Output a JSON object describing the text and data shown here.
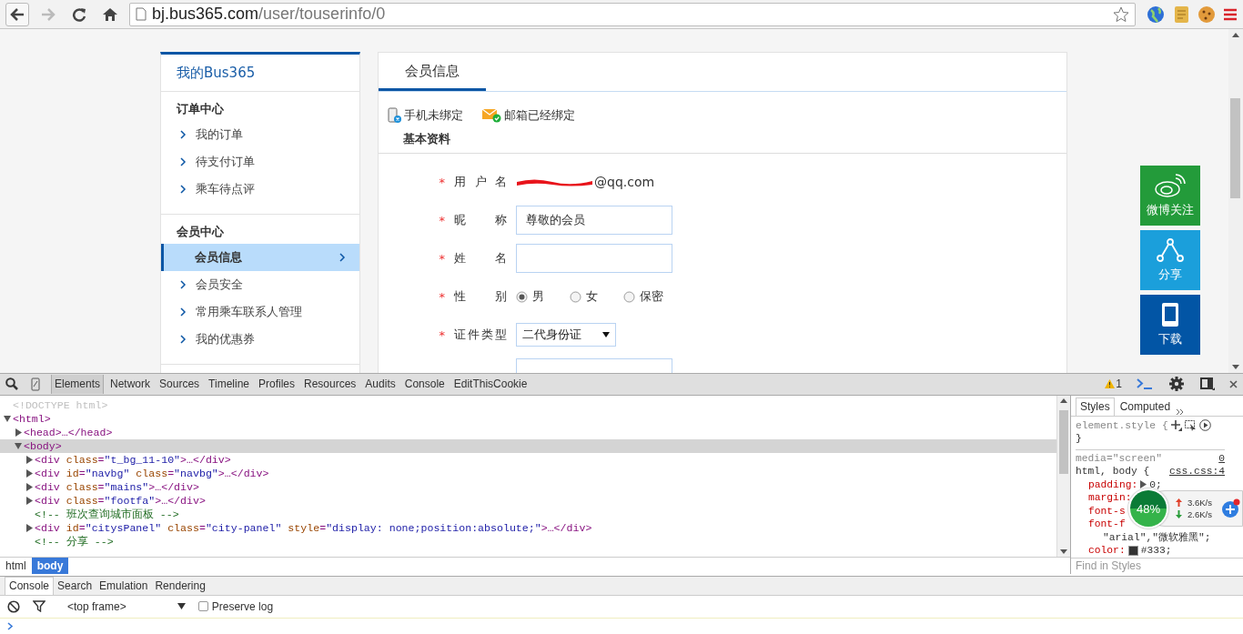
{
  "browser": {
    "url_host": "bj.bus365.com",
    "url_path": "/user/touserinfo/0",
    "forward_disabled": true
  },
  "sidebar": {
    "title": "我的Bus365",
    "groups": [
      {
        "heading": "订单中心",
        "items": [
          {
            "label": "我的订单",
            "selected": false
          },
          {
            "label": "待支付订单",
            "selected": false
          },
          {
            "label": "乘车待点评",
            "selected": false
          }
        ]
      },
      {
        "heading": "会员中心",
        "items": [
          {
            "label": "会员信息",
            "selected": true
          },
          {
            "label": "会员安全",
            "selected": false
          },
          {
            "label": "常用乘车联系人管理",
            "selected": false
          },
          {
            "label": "我的优惠券",
            "selected": false
          }
        ]
      }
    ]
  },
  "main": {
    "tab": "会员信息",
    "bindings": [
      {
        "kind": "phone",
        "label": "手机未绑定"
      },
      {
        "kind": "email",
        "label": "邮箱已经绑定"
      }
    ],
    "section": "基本资料",
    "fields": [
      {
        "kind": "text",
        "mark": "*",
        "label": "用户名",
        "value": "@qq.com",
        "redacted": true
      },
      {
        "kind": "input",
        "mark": "*",
        "label": "昵称",
        "value": "尊敬的会员"
      },
      {
        "kind": "input",
        "mark": "*",
        "label": "姓名"
      },
      {
        "kind": "radio",
        "mark": "*",
        "label": "性别",
        "options": [
          {
            "label": "男",
            "selected": true
          },
          {
            "label": "女",
            "selected": false
          },
          {
            "label": "保密",
            "selected": false
          }
        ]
      },
      {
        "kind": "select",
        "mark": "*",
        "label": "证件类型",
        "value": "二代身份证"
      },
      {
        "kind": "input"
      }
    ]
  },
  "side_buttons": [
    {
      "kind": "weibo",
      "label": "微博关注",
      "color": "#239b3a"
    },
    {
      "kind": "share",
      "label": "分享",
      "color": "#1b9fdb"
    },
    {
      "kind": "download",
      "label": "下载",
      "color": "#0255a5"
    }
  ],
  "devtools": {
    "tabs": [
      {
        "label": "Elements",
        "selected": true
      },
      {
        "label": "Network",
        "selected": false
      },
      {
        "label": "Sources",
        "selected": false
      },
      {
        "label": "Timeline",
        "selected": false
      },
      {
        "label": "Profiles",
        "selected": false
      },
      {
        "label": "Resources",
        "selected": false
      },
      {
        "label": "Audits",
        "selected": false
      },
      {
        "label": "Console",
        "selected": false
      },
      {
        "label": "EditThisCookie",
        "selected": false
      }
    ],
    "warning_count": "1",
    "dom": [
      {
        "code": "<!DOCTYPE html>",
        "kind": "doctype"
      },
      {
        "code": "<html>",
        "expanded": true,
        "selected": false,
        "children": [
          {
            "code": "<head>…</head>",
            "expanded": false,
            "selected": false
          },
          {
            "code": "<body>",
            "expanded": true,
            "selected": true,
            "children": [
              {
                "code": "<div class=\"t_bg_11-10\">…</div>",
                "expanded": false,
                "selected": false
              },
              {
                "code": "<div id=\"navbg\" class=\"navbg\">…</div>",
                "expanded": false,
                "selected": false
              },
              {
                "code": "<div class=\"mains\">…</div>",
                "expanded": false,
                "selected": false
              },
              {
                "code": "<div class=\"footfa\">…</div>",
                "expanded": false,
                "selected": false
              },
              {
                "code": "<!-- 班次查询城市面板 -->",
                "kind": "comment"
              },
              {
                "code": "<div id=\"citysPanel\" class=\"city-panel\" style=\"display: none;position:absolute;\">…</div>",
                "expanded": false,
                "selected": false
              },
              {
                "code": "<!-- 分享 -->",
                "kind": "comment"
              }
            ]
          }
        ]
      }
    ],
    "breadcrumbs": [
      {
        "label": "html",
        "selected": false
      },
      {
        "label": "body",
        "selected": true
      }
    ],
    "styles_tabs": [
      {
        "label": "Styles",
        "selected": true
      },
      {
        "label": "Computed",
        "selected": false
      }
    ],
    "element_style": "element.style {",
    "element_style_close": "}",
    "rule": {
      "media": "media=\"screen\"",
      "media_link": "0",
      "selector": "html, body {",
      "source": "css.css:4",
      "props": [
        {
          "name": "padding:",
          "value": "0;",
          "expandable": true
        },
        {
          "name": "margin:"
        },
        {
          "name": "font-s"
        },
        {
          "name": "font-f"
        },
        {
          "value": "\"arial\",\"微软雅黑\";"
        },
        {
          "kind": "color",
          "name": "color:",
          "value": "#333;"
        }
      ]
    },
    "styles_filter": {
      "placeholder": "Find in Styles"
    },
    "drawer_tabs": [
      {
        "label": "Console",
        "selected": true
      },
      {
        "label": "Search",
        "selected": false
      },
      {
        "label": "Emulation",
        "selected": false
      },
      {
        "label": "Rendering",
        "selected": false
      }
    ],
    "frame": "<top frame>",
    "preserve_log": {
      "label": "Preserve log",
      "checked": false
    }
  },
  "net_widget": {
    "percent": "48%",
    "up": "3.6K/s",
    "down": "2.6K/s"
  }
}
